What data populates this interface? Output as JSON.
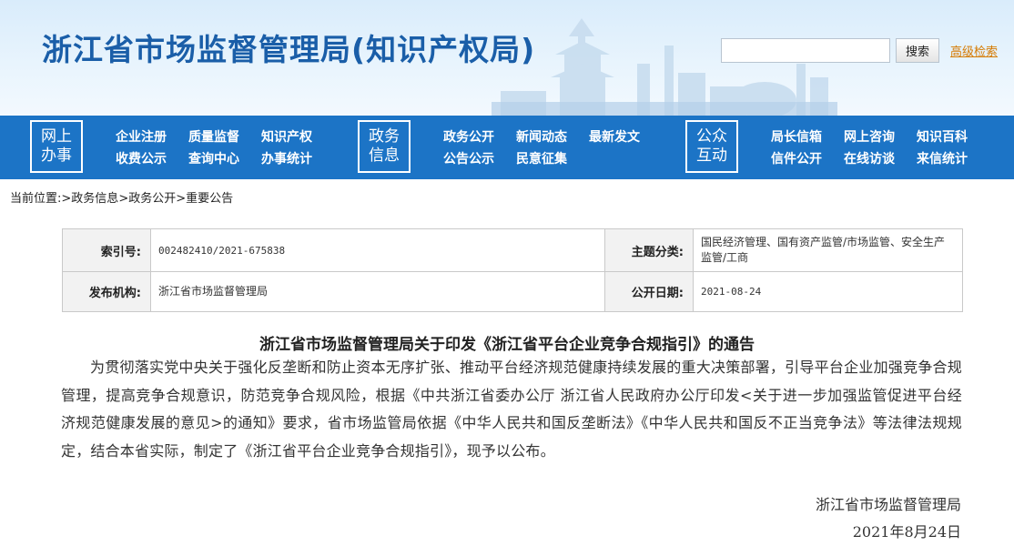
{
  "header": {
    "site_title": "浙江省市场监督管理局(知识产权局)",
    "search_placeholder": "",
    "search_button": "搜索",
    "advanced_search": "高级检索"
  },
  "nav": {
    "groups": [
      {
        "box": [
          "网上",
          "办事"
        ],
        "links": [
          "企业注册",
          "质量监督",
          "知识产权",
          "收费公示",
          "查询中心",
          "办事统计"
        ]
      },
      {
        "box": [
          "政务",
          "信息"
        ],
        "links": [
          "政务公开",
          "新闻动态",
          "最新发文",
          "公告公示",
          "民意征集"
        ]
      },
      {
        "box": [
          "公众",
          "互动"
        ],
        "links": [
          "局长信箱",
          "网上咨询",
          "知识百科",
          "信件公开",
          "在线访谈",
          "来信统计"
        ]
      }
    ]
  },
  "breadcrumb": {
    "prefix": "当前位置:",
    "items": [
      "政务信息",
      "政务公开",
      "重要公告"
    ],
    "sep": ">"
  },
  "meta": {
    "index_label": "索引号:",
    "index_value": "002482410/2021-675838",
    "topic_label": "主题分类:",
    "topic_value": "国民经济管理、国有资产监管/市场监管、安全生产监管/工商",
    "publisher_label": "发布机构:",
    "publisher_value": "浙江省市场监督管理局",
    "date_label": "公开日期:",
    "date_value": "2021-08-24"
  },
  "article": {
    "title": "浙江省市场监督管理局关于印发《浙江省平台企业竞争合规指引》的通告",
    "body": "为贯彻落实党中央关于强化反垄断和防止资本无序扩张、推动平台经济规范健康持续发展的重大决策部署，引导平台企业加强竞争合规管理，提高竞争合规意识，防范竞争合规风险，根据《中共浙江省委办公厅 浙江省人民政府办公厅印发<关于进一步加强监管促进平台经济规范健康发展的意见>的通知》要求，省市场监管局依据《中华人民共和国反垄断法》《中华人民共和国反不正当竞争法》等法律法规规定，结合本省实际，制定了《浙江省平台企业竞争合规指引》，现予以公布。",
    "signature": "浙江省市场监督管理局",
    "date": "2021年8月24日"
  },
  "colors": {
    "title_blue": "#1a5ea8",
    "nav_blue": "#1c74c6",
    "advanced_link": "#d57a00"
  }
}
